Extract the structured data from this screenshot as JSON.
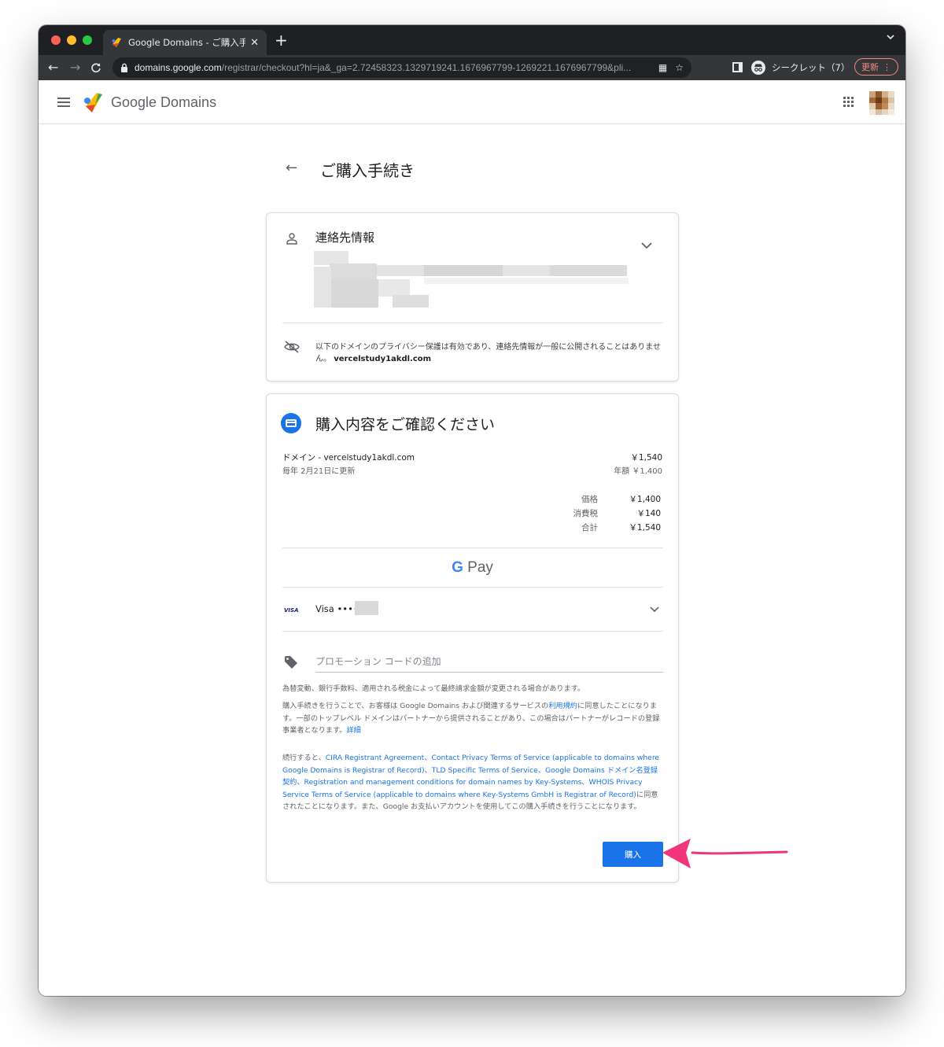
{
  "browser": {
    "tab_title": "Google Domains - ご購入手続き",
    "tab_close": "✕",
    "new_tab": "+",
    "url_host": "domains.google.com",
    "url_path": "/registrar/checkout?hl=ja&_ga=2.72458323.1329719241.1676967799-1269221.1676967799&pli...",
    "incognito_label": "シークレット（7）",
    "update_label": "更新"
  },
  "header": {
    "logo_text": "Google Domains"
  },
  "page": {
    "title": "ご購入手続き"
  },
  "contact": {
    "title": "連絡先情報",
    "privacy_text": "以下のドメインのプライバシー保護は有効であり、連絡先情報が一般に公開されることはありません。",
    "privacy_domain": "vercelstudy1akdl.com"
  },
  "review": {
    "title": "購入内容をご確認ください",
    "line_label": "ドメイン - vercelstudy1akdl.com",
    "line_renew": "毎年 2月21日に更新",
    "line_price": "￥1,540",
    "line_annual": "年額 ￥1,400",
    "totals": [
      {
        "label": "価格",
        "value": "￥1,400"
      },
      {
        "label": "消費税",
        "value": "￥140"
      },
      {
        "label": "合計",
        "value": "￥1,540"
      }
    ],
    "gpay_g": "G",
    "gpay_label": "Pay",
    "visa_badge": "VISA",
    "visa_label": "Visa ••••",
    "promo_placeholder": "プロモーション コードの追加",
    "fine1": "為替変動、銀行手数料、適用される税金によって最終請求金額が変更される場合があります。",
    "fine2_pre": "購入手続きを行うことで、お客様は Google Domains および関連するサービスの",
    "fine2_link1": "利用規約",
    "fine2_mid": "に同意したことになります。一部のトップレベル ドメインはパートナーから提供されることがあり、この場合はパートナーがレコードの登録事業者となります。",
    "fine2_link2": "詳細",
    "fine3_pre": "続行すると、",
    "fine3_links": "CIRA Registrant Agreement、Contact Privacy Terms of Service (applicable to domains where Google Domains is Registrar of Record)、TLD Specific Terms of Service、Google Domains ドメイン名登録契約、Registration and management conditions for domain names by Key-Systems、WHOIS Privacy Service Terms of Service (applicable to domains where Key-Systems GmbH is Registrar of Record)",
    "fine3_post": "に同意されたことになります。また、Google お支払いアカウントを使用してこの購入手続きを行うことになります。",
    "buy_label": "購入"
  },
  "colors": {
    "accent": "#1a73e8",
    "annotation_arrow": "#f0357a"
  }
}
